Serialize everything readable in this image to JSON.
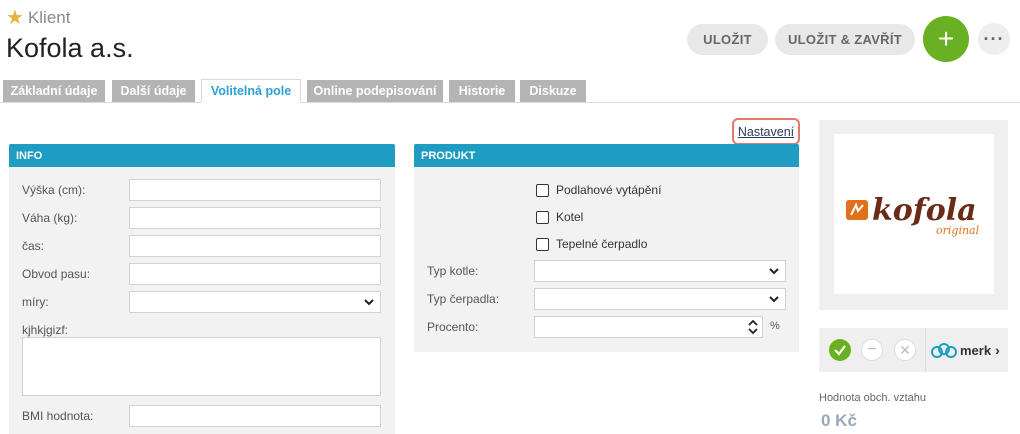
{
  "header": {
    "entity_type": "Klient",
    "title": "Kofola a.s.",
    "save_label": "ULOŽIT",
    "save_close_label": "ULOŽIT & ZAVŘÍT",
    "add_label": "+",
    "more_label": "···"
  },
  "tabs": [
    {
      "label": "Základní údaje",
      "active": false
    },
    {
      "label": "Další údaje",
      "active": false
    },
    {
      "label": "Volitelná pole",
      "active": true
    },
    {
      "label": "Online podepisování",
      "active": false
    },
    {
      "label": "Historie",
      "active": false
    },
    {
      "label": "Diskuze",
      "active": false
    }
  ],
  "settings_link": "Nastavení",
  "info": {
    "heading": "INFO",
    "fields": {
      "height": {
        "label": "Výška (cm):",
        "value": ""
      },
      "weight": {
        "label": "Váha (kg):",
        "value": ""
      },
      "time": {
        "label": "čas:",
        "value": ""
      },
      "waist": {
        "label": "Obvod pasu:",
        "value": ""
      },
      "measures": {
        "label": "míry:",
        "value": ""
      },
      "notes": {
        "label": "kjhkjgizf:",
        "value": ""
      },
      "bmi": {
        "label": "BMI hodnota:",
        "value": ""
      }
    }
  },
  "product": {
    "heading": "PRODUKT",
    "checkboxes": [
      {
        "label": "Podlahové vytápění",
        "checked": false
      },
      {
        "label": "Kotel",
        "checked": false
      },
      {
        "label": "Tepelné čerpadlo",
        "checked": false
      }
    ],
    "boiler_type": {
      "label": "Typ kotle:",
      "value": ""
    },
    "pump_type": {
      "label": "Typ čerpadla:",
      "value": ""
    },
    "percent": {
      "label": "Procento:",
      "value": "",
      "unit": "%"
    }
  },
  "logo": {
    "brand": "kofola",
    "tagline": "original"
  },
  "merk": {
    "label": "merk"
  },
  "relationship": {
    "label": "Hodnota obch. vztahu",
    "value": "0 Kč"
  },
  "colors": {
    "accent": "#1f9cc1",
    "green": "#6ab023",
    "brand_brown": "#6b2b16",
    "brand_orange": "#e0701b"
  }
}
